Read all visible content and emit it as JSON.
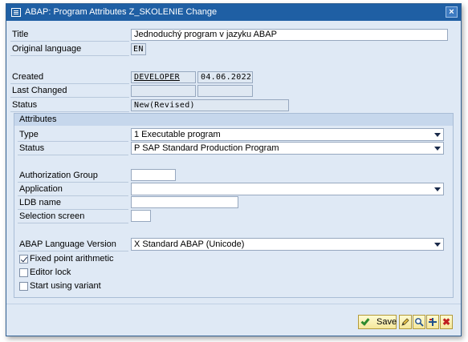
{
  "window": {
    "title": "ABAP: Program Attributes Z_SKOLENIE Change",
    "close_glyph": "×"
  },
  "fields": {
    "title_label": "Title",
    "title_value": "Jednoduchý program v jazyku ABAP",
    "orig_lang_label": "Original language",
    "orig_lang_value": "EN",
    "created_label": "Created",
    "created_user": "DEVELOPER",
    "created_date": "04.06.2022",
    "last_changed_label": "Last Changed",
    "last_changed_user": "",
    "last_changed_date": "",
    "status_label": "Status",
    "status_value": "New(Revised)"
  },
  "attributes": {
    "header": "Attributes",
    "type_label": "Type",
    "type_value": "1 Executable program",
    "status_label": "Status",
    "status_value": "P SAP Standard Production Program",
    "auth_group_label": "Authorization Group",
    "auth_group_value": "",
    "application_label": "Application",
    "application_value": "",
    "ldb_label": "LDB name",
    "ldb_value": "",
    "selection_screen_label": "Selection screen",
    "selection_screen_value": "",
    "abap_version_label": "ABAP Language Version",
    "abap_version_value": "X Standard ABAP (Unicode)",
    "checkboxes": [
      {
        "label": "Fixed point arithmetic",
        "checked": true
      },
      {
        "label": "Editor lock",
        "checked": false
      },
      {
        "label": "Start using variant",
        "checked": false
      }
    ]
  },
  "footer": {
    "save_label": "Save",
    "icons": [
      "edit-icon",
      "find-icon",
      "layout-icon",
      "cancel-icon"
    ],
    "cancel_glyph": "✖"
  }
}
